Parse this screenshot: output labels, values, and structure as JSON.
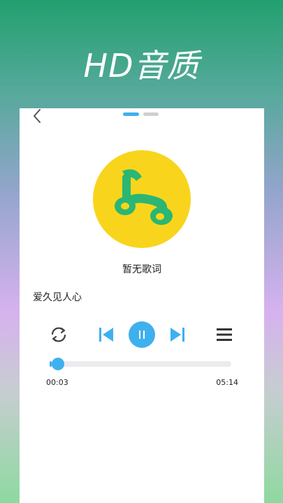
{
  "promo": {
    "title": "HD音质"
  },
  "player": {
    "lyrics": "暂无歌词",
    "song_title": "爱久见人心",
    "current_time": "00:03",
    "total_time": "05:14",
    "progress": 0.01,
    "page_indicator": {
      "count": 2,
      "active": 0
    },
    "colors": {
      "accent": "#3fb0ee",
      "album_bg": "#f8d51c",
      "album_icon": "#2bb673"
    },
    "icons": {
      "back": "chevron-left-icon",
      "repeat": "repeat-icon",
      "prev": "skip-previous-icon",
      "play_pause": "pause-icon",
      "next": "skip-next-icon",
      "playlist": "menu-icon"
    }
  }
}
